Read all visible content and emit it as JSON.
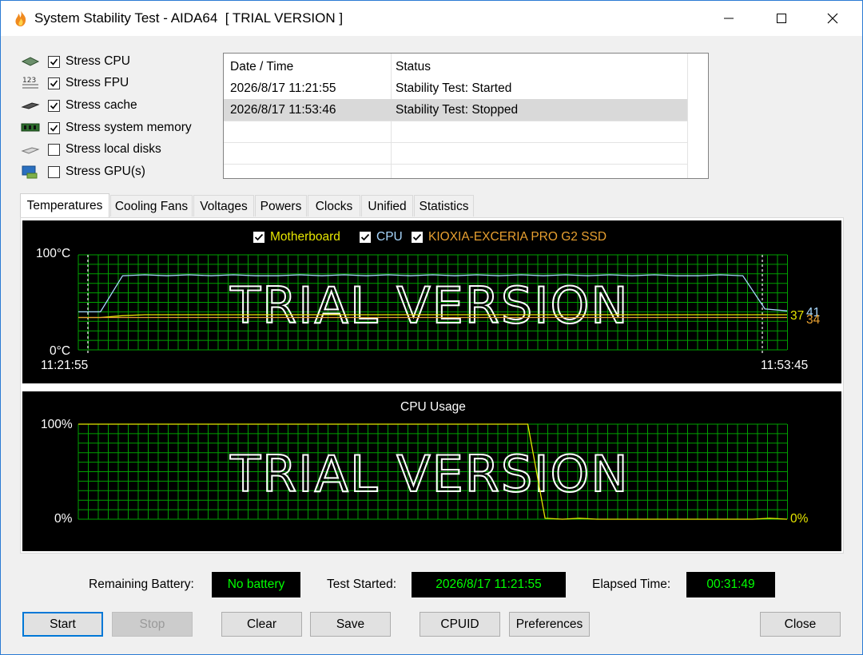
{
  "window": {
    "title": "System Stability Test - AIDA64  [ TRIAL VERSION ]",
    "app_icon": "flame-icon",
    "minimize_icon": "minimize-icon",
    "maximize_icon": "maximize-icon",
    "close_icon": "close-icon"
  },
  "stress_options": [
    {
      "label": "Stress CPU",
      "checked": true,
      "icon": "cpu-icon"
    },
    {
      "label": "Stress FPU",
      "checked": true,
      "icon": "fpu-123-icon"
    },
    {
      "label": "Stress cache",
      "checked": true,
      "icon": "cache-icon"
    },
    {
      "label": "Stress system memory",
      "checked": true,
      "icon": "memory-icon"
    },
    {
      "label": "Stress local disks",
      "checked": false,
      "icon": "disk-icon"
    },
    {
      "label": "Stress GPU(s)",
      "checked": false,
      "icon": "gpu-icon"
    }
  ],
  "log": {
    "columns": [
      "Date / Time",
      "Status"
    ],
    "rows": [
      {
        "datetime": "2026/8/17 11:21:55",
        "status": "Stability Test: Started",
        "selected": false
      },
      {
        "datetime": "2026/8/17 11:53:46",
        "status": "Stability Test: Stopped",
        "selected": true
      }
    ]
  },
  "tabs": [
    "Temperatures",
    "Cooling Fans",
    "Voltages",
    "Powers",
    "Clocks",
    "Unified",
    "Statistics"
  ],
  "active_tab": "Temperatures",
  "colors": {
    "grid": "#00a000",
    "motherboard": "#e6e600",
    "cpu": "#a8d8ff",
    "ssd": "#e8a030",
    "usage": "#e6e600",
    "status_text": "#00ff00",
    "accent": "#0078d7"
  },
  "chart_data": [
    {
      "type": "line",
      "legend": [
        {
          "name": "Motherboard",
          "checked": true
        },
        {
          "name": "CPU",
          "checked": true
        },
        {
          "name": "KIOXIA-EXCERIA PRO G2 SSD",
          "checked": true
        }
      ],
      "ymax_label": "100°C",
      "ymin_label": "0°C",
      "ylim": [
        0,
        100
      ],
      "x_start": "11:21:55",
      "x_end": "11:53:45",
      "watermark": "TRIAL VERSION",
      "end_values": [
        {
          "text": "37",
          "series": "Motherboard"
        },
        {
          "text": "41",
          "series": "CPU"
        },
        {
          "text": "34",
          "series": "KIOXIA-EXCERIA PRO G2 SSD"
        }
      ],
      "series": [
        {
          "name": "CPU",
          "values": [
            40,
            40,
            78,
            79,
            78,
            79,
            78,
            79,
            78,
            78,
            79,
            78,
            79,
            78,
            79,
            78,
            79,
            78,
            79,
            78,
            79,
            78,
            79,
            78,
            79,
            78,
            79,
            78,
            78,
            79,
            78,
            43,
            41
          ]
        },
        {
          "name": "Motherboard",
          "values": [
            34,
            34,
            36,
            37,
            37,
            37,
            37,
            37,
            37,
            37,
            37,
            37,
            37,
            37,
            37,
            37,
            37,
            37,
            37,
            37,
            37,
            37,
            37,
            37,
            37,
            37,
            37,
            37,
            37,
            37,
            37,
            37,
            37
          ]
        },
        {
          "name": "KIOXIA-EXCERIA PRO G2 SSD",
          "values": [
            34,
            34,
            34,
            34,
            34,
            34,
            34,
            34,
            34,
            34,
            34,
            34,
            34,
            34,
            34,
            34,
            34,
            34,
            34,
            34,
            34,
            34,
            34,
            34,
            34,
            34,
            34,
            34,
            34,
            34,
            34,
            34,
            34
          ]
        }
      ]
    },
    {
      "type": "line",
      "title": "CPU Usage",
      "ymax_label": "100%",
      "ymin_label": "0%",
      "ylim": [
        0,
        100
      ],
      "watermark": "TRIAL VERSION",
      "end_value": "0%",
      "series": [
        {
          "name": "CPU Usage",
          "values": [
            100,
            100,
            100,
            100,
            100,
            100,
            100,
            100,
            100,
            100,
            100,
            100,
            100,
            100,
            100,
            100,
            100,
            100,
            100,
            100,
            100,
            100,
            100,
            100,
            100,
            100,
            100,
            1,
            0,
            1,
            0,
            0,
            0,
            0,
            0,
            0,
            0,
            0,
            0,
            0,
            1,
            0
          ]
        }
      ]
    }
  ],
  "footer": {
    "battery_label": "Remaining Battery:",
    "battery_value": "No battery",
    "started_label": "Test Started:",
    "started_value": "2026/8/17 11:21:55",
    "elapsed_label": "Elapsed Time:",
    "elapsed_value": "00:31:49"
  },
  "buttons": {
    "start": "Start",
    "stop": "Stop",
    "clear": "Clear",
    "save": "Save",
    "cpuid": "CPUID",
    "preferences": "Preferences",
    "close": "Close"
  }
}
